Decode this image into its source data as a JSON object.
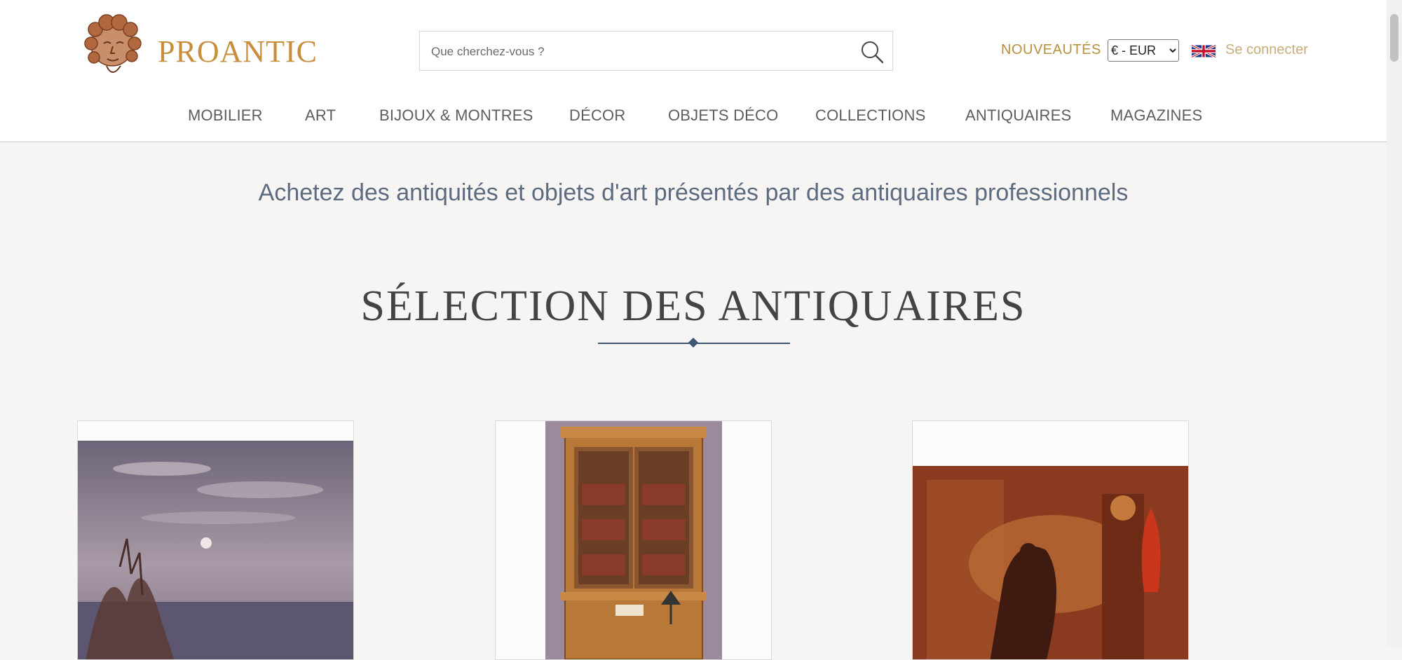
{
  "header": {
    "logo_text": "PROANTIC",
    "search": {
      "placeholder": "Que cherchez-vous ?"
    },
    "nouveautes": "NOUVEAUTÉS",
    "currency": {
      "selected": "€ - EUR"
    },
    "language_flag": "uk-flag-icon",
    "login": "Se connecter"
  },
  "nav": {
    "items": [
      {
        "label": "MOBILIER"
      },
      {
        "label": "ART"
      },
      {
        "label": "BIJOUX & MONTRES"
      },
      {
        "label": "DÉCOR"
      },
      {
        "label": "OBJETS DÉCO"
      },
      {
        "label": "COLLECTIONS"
      },
      {
        "label": "ANTIQUAIRES"
      },
      {
        "label": "MAGAZINES"
      }
    ]
  },
  "main": {
    "tagline": "Achetez des antiquités et objets d'art présentés par des antiquaires professionnels",
    "section_title": "SÉLECTION DES ANTIQUAIRES",
    "products": [
      {
        "image": "landscape-painting-image"
      },
      {
        "image": "bookcase-cabinet-image"
      },
      {
        "image": "tapestry-painting-image"
      }
    ]
  },
  "colors": {
    "brand_gold": "#c98e3c",
    "nav_text": "#5d5d5d",
    "tagline_blue": "#5c6b80",
    "accent_rule": "#3e5574"
  }
}
